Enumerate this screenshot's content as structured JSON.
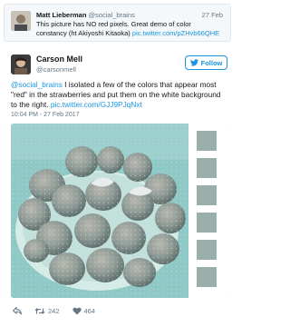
{
  "quoted_tweet": {
    "author_name": "Matt Lieberman",
    "author_handle": "@social_brains",
    "date": "27 Feb",
    "text": "This picture has NO red pixels. Great demo of color constancy (ht Akiyoshi Kitaoka)",
    "link": "pic.twitter.com/pZHvb66QHE"
  },
  "tweet": {
    "author_name": "Carson Mell",
    "author_handle": "@carsonmell",
    "follow_label": "Follow",
    "mention": "@social_brains",
    "text": " I isolated a few of the colors that appear most \"red\" in the strawberries and put them on the white background to the right. ",
    "link": "pic.twitter.com/GJJ9PJqNxt",
    "timestamp": "10:04 PM - 27 Feb 2017"
  },
  "actions": {
    "replies": "",
    "retweets": "242",
    "likes": "464"
  },
  "colors": {
    "link": "#1b95e0",
    "photo_tint": "#8ec9c8",
    "swatch": "#9aaeab"
  },
  "icons": [
    "reply-icon",
    "retweet-icon",
    "heart-icon",
    "twitter-bird-icon"
  ]
}
